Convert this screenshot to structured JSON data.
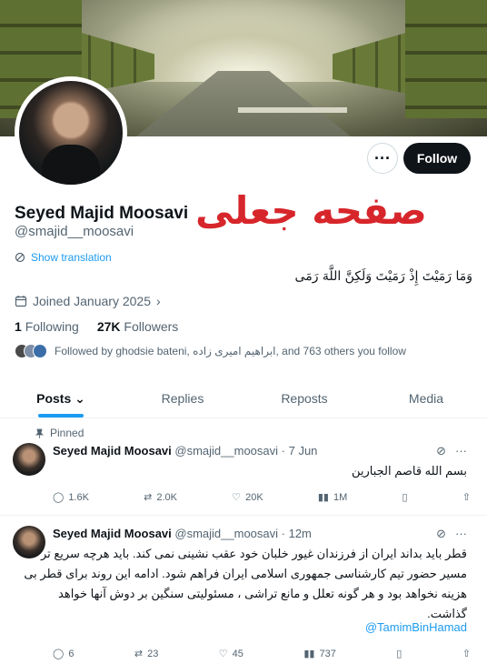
{
  "profile": {
    "name": "Seyed Majid Moosavi",
    "handle": "@smajid__moosavi",
    "overlay_label": "صفحه جعلی",
    "show_translation": "Show translation",
    "bio": "وَمَا رَمَيْتَ إِذْ رَمَيْتَ وَلَكِنَّ اللَّهَ رَمَى",
    "joined": "Joined January 2025",
    "following_count": "1",
    "following_label": "Following",
    "followers_count": "27K",
    "followers_label": "Followers",
    "followed_by": "Followed by ghodsie bateni, ابراهیم امیری زاده, and 763 others you follow",
    "more_label": "···",
    "follow_label": "Follow"
  },
  "tabs": [
    "Posts",
    "Replies",
    "Reposts",
    "Media"
  ],
  "pinned_label": "Pinned",
  "posts": [
    {
      "author": "Seyed Majid Moosavi",
      "handle": "@smajid__moosavi",
      "time": "· 7 Jun",
      "text": "بسم الله قاصم الجبارين",
      "replies": "1.6K",
      "reposts": "2.0K",
      "likes": "20K",
      "views": "1M"
    },
    {
      "author": "Seyed Majid Moosavi",
      "handle": "@smajid__moosavi",
      "time": "· 12m",
      "text_lines": [
        "قطر باید بداند ایران از فرزندان غیور خلبان خود عقب نشینی نمی کند. باید هرچه سریع تر",
        "مسیر حضور تیم کارشناسی جمهوری اسلامی ایران فراهم شود. ادامه این روند برای قطر بی",
        "هزینه نخواهد بود و هر گونه تعلل و مانع تراشی ، مسئولیتی سنگین بر دوش آنها خواهد",
        "گذاشت."
      ],
      "link": "@TamimBinHamad",
      "replies": "6",
      "reposts": "23",
      "likes": "45",
      "views": "737"
    }
  ]
}
